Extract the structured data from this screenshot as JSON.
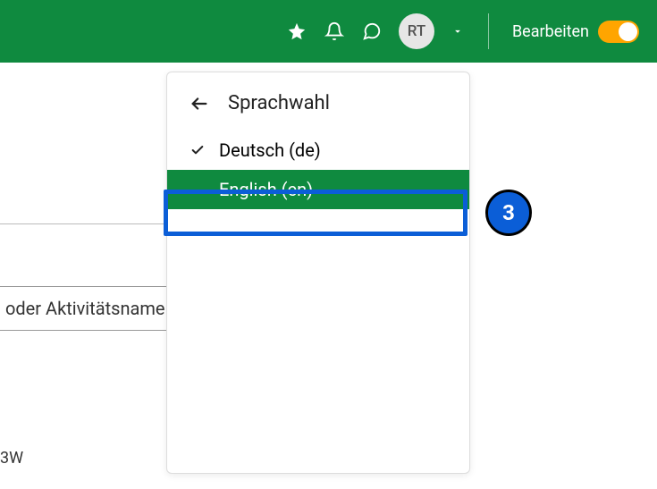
{
  "header": {
    "avatar_initials": "RT",
    "edit_label": "Bearbeiten"
  },
  "dropdown": {
    "title": "Sprachwahl",
    "items": [
      {
        "label": "Deutsch (de)",
        "checked": true,
        "selected": false
      },
      {
        "label": "English (en)",
        "checked": false,
        "selected": true
      }
    ]
  },
  "step_badge": "3",
  "background": {
    "input_fragment": "oder Aktivitätsname",
    "bottom_fragment": "3W"
  }
}
